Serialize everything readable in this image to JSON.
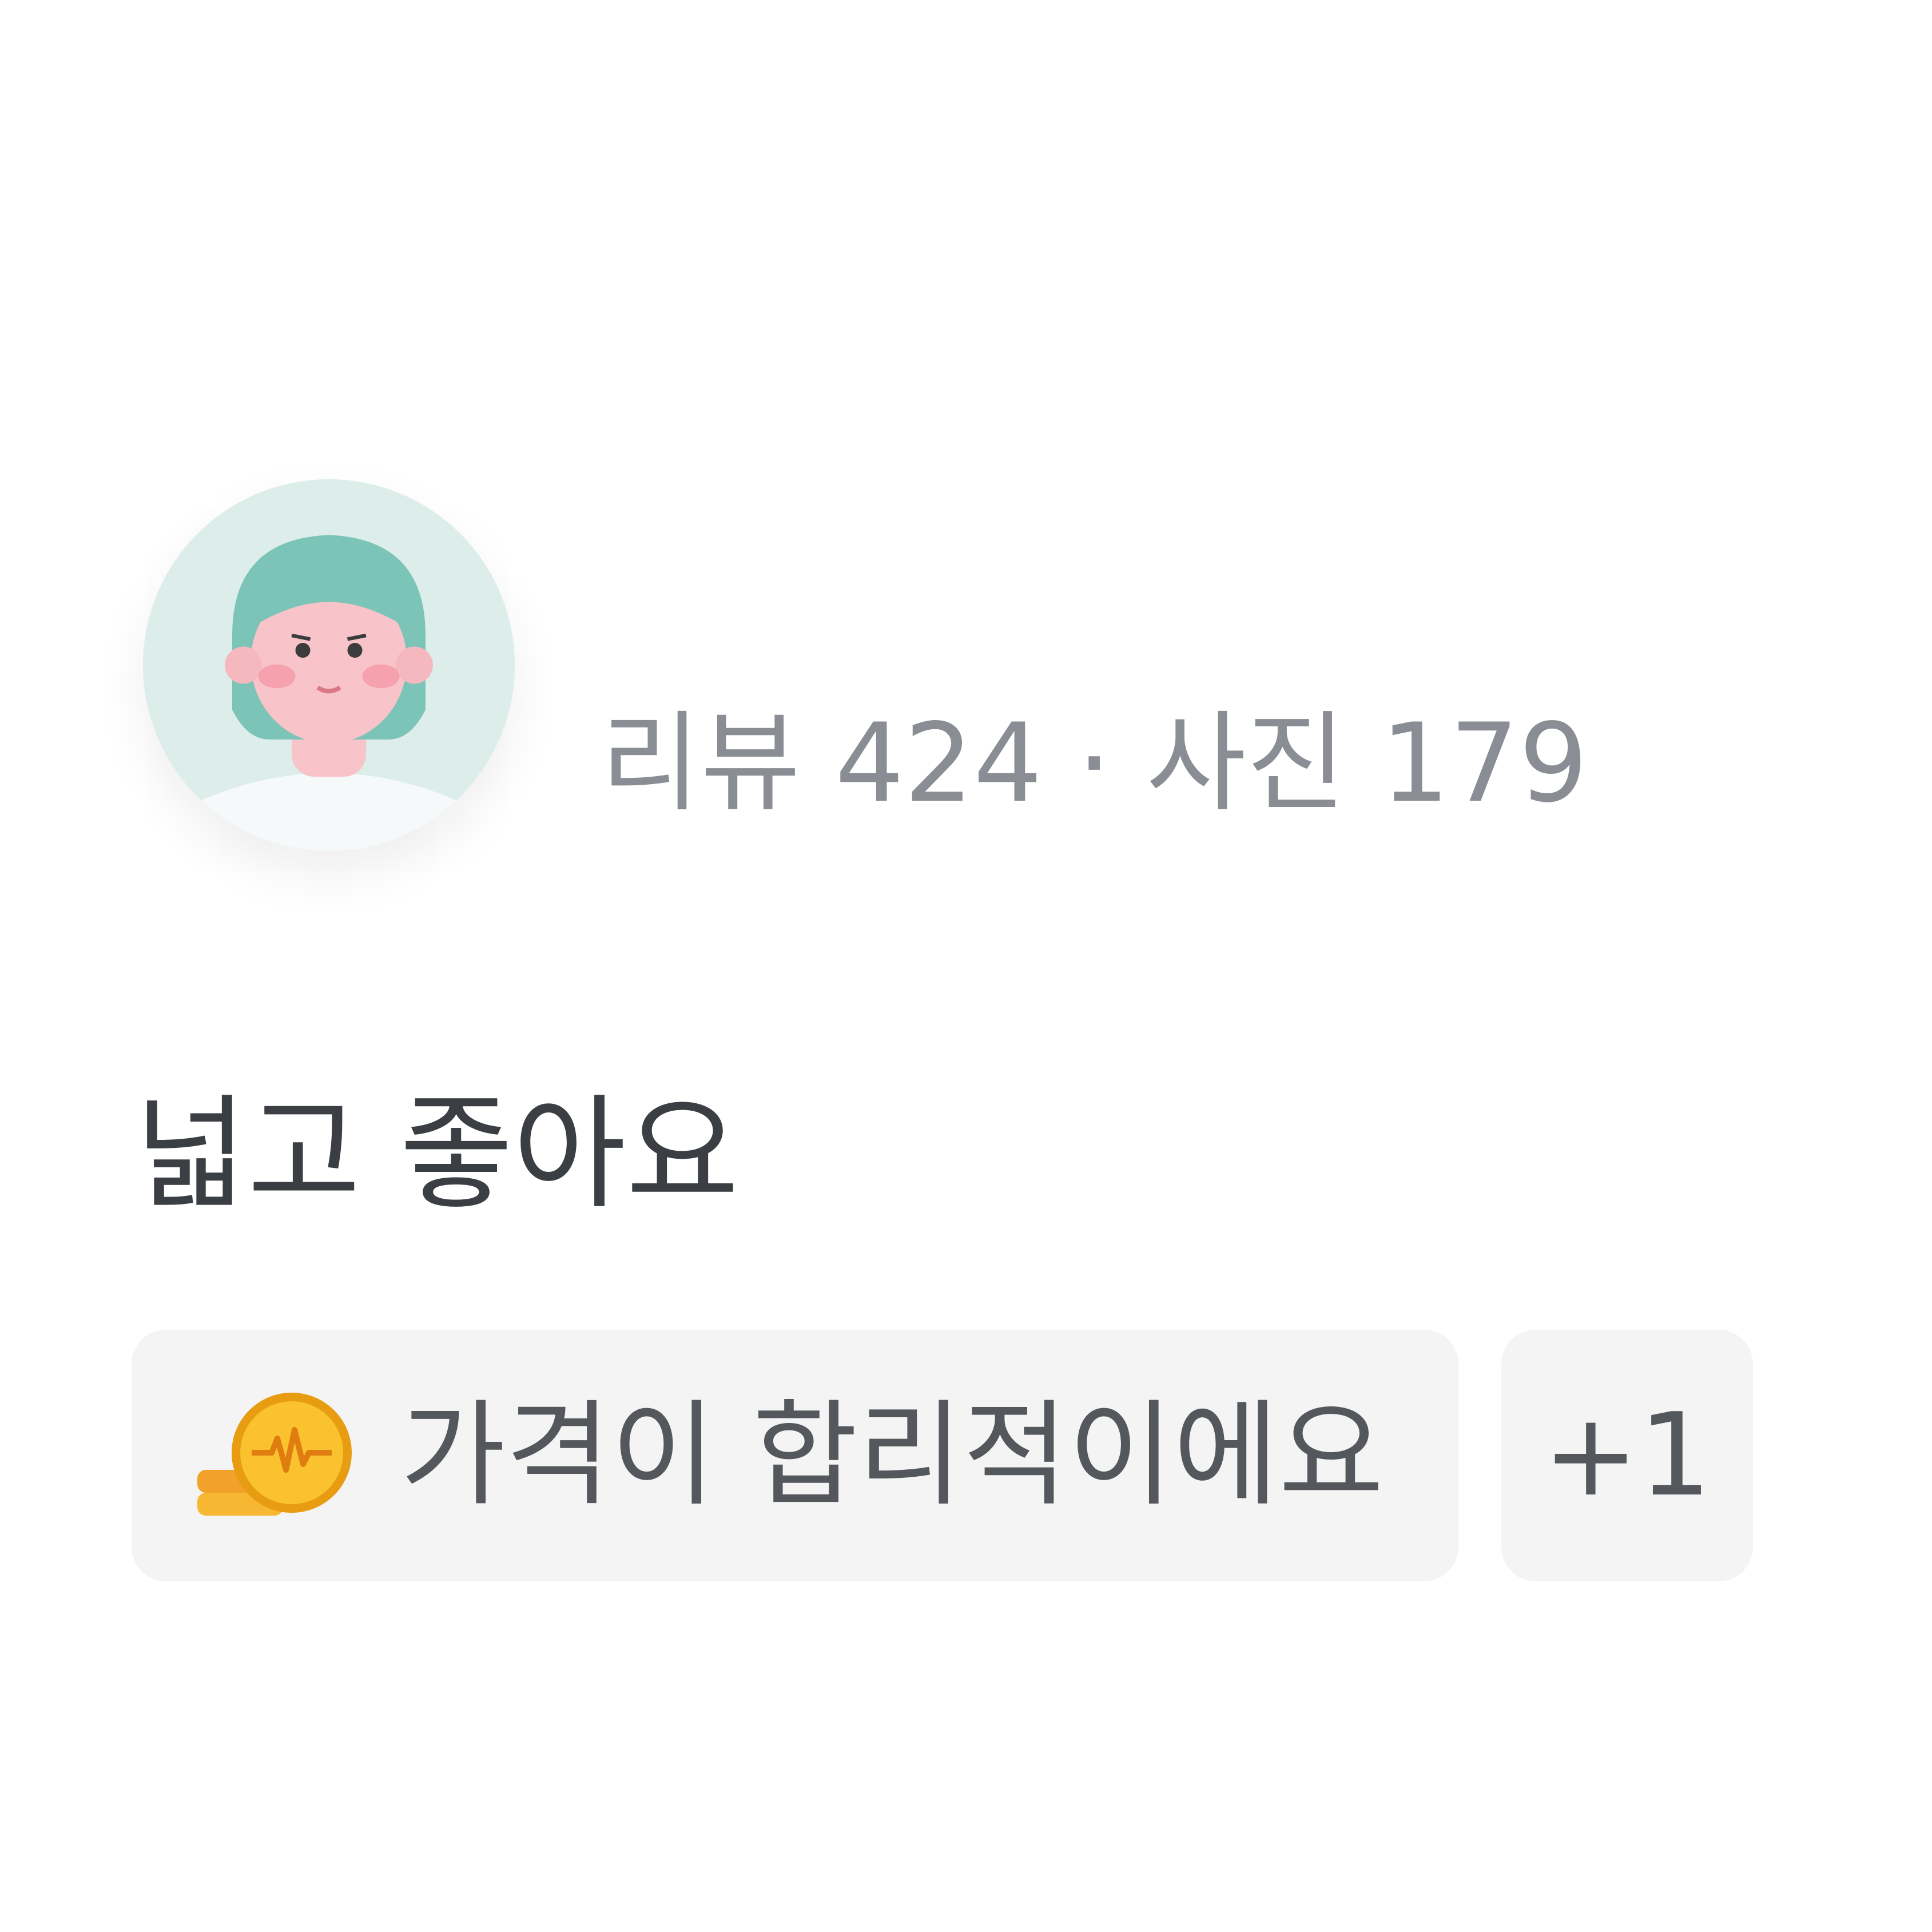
{
  "author": {
    "avatar_icon": "person-avatar-icon",
    "stats": "리뷰 424 · 사진 179"
  },
  "review": {
    "text": "넓고 좋아요"
  },
  "tags": {
    "primary": {
      "icon": "coin-icon",
      "label": "가격이 합리적이에요"
    },
    "more_label": "+1"
  },
  "colors": {
    "avatar_background": "#dcedea",
    "avatar_hair": "#7cc4b8",
    "chip_background": "#f4f4f4",
    "stats_text": "#8a8e94",
    "body_text": "#3b3f44",
    "coin": "#f5b921"
  }
}
